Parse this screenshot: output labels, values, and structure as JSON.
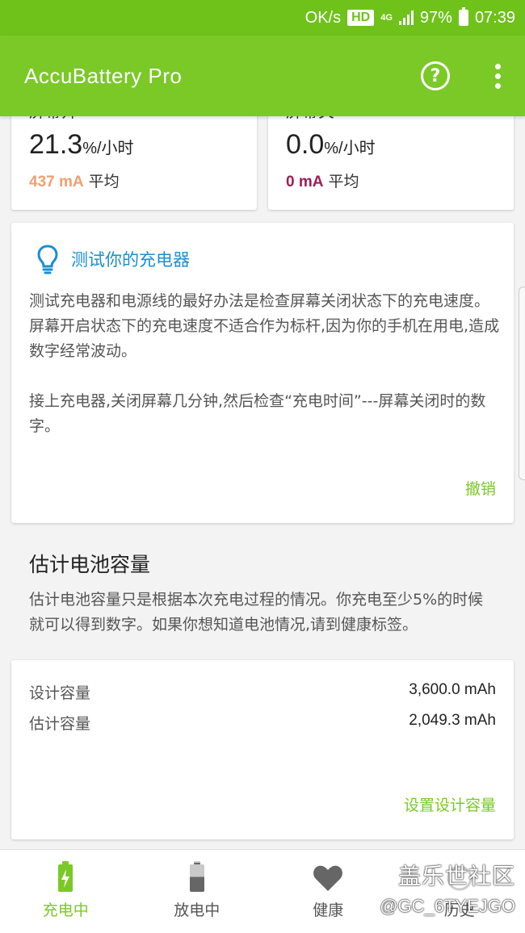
{
  "status_bar": {
    "speed": "OK/s",
    "hd": "HD",
    "network": "4G",
    "battery": "97%",
    "time": "07:39"
  },
  "app_bar": {
    "title": "AccuBattery Pro",
    "help_icon": "help-circle-icon",
    "menu_icon": "more-vertical-icon"
  },
  "stats": {
    "left": {
      "label": "屏幕开",
      "value": "21.3",
      "unit": "%/小时",
      "avg_ma": "437 mA",
      "avg_label": "平均",
      "avg_color": "#f0a070"
    },
    "right": {
      "label": "屏幕关",
      "value": "0.0",
      "unit": "%/小时",
      "avg_ma": "0 mA",
      "avg_label": "平均",
      "avg_color": "#9c1f55"
    }
  },
  "tip": {
    "icon": "lightbulb-icon",
    "title": "测试你的充电器",
    "para1": "测试充电器和电源线的最好办法是检查屏幕关闭状态下的充电速度。屏幕开启状态下的充电速度不适合作为标杆,因为你的手机在用电,造成数字经常波动。",
    "para2": "接上充电器,关闭屏幕几分钟,然后检查“充电时间”---屏幕关闭时的数字。",
    "dismiss": "撤销"
  },
  "capacity": {
    "title": "估计电池容量",
    "description": "估计电池容量只是根据本次充电过程的情况。你充电至少5%的时候就可以得到数字。如果你想知道电池情况,请到健康标签。",
    "design_label": "设计容量",
    "design_value": "3,600.0 mAh",
    "estimated_label": "估计容量",
    "estimated_value": "2,049.3 mAh",
    "action": "设置设计容量"
  },
  "bottom_nav": {
    "charging": "充电中",
    "discharging": "放电中",
    "health": "健康",
    "history": "历史"
  },
  "watermark": {
    "line1": "盖乐世社区",
    "line2": "@GC_6TYEJGO"
  },
  "colors": {
    "accent": "#7ac926",
    "status_bar": "#6ec21a",
    "tip_title": "#1a8fd0"
  }
}
